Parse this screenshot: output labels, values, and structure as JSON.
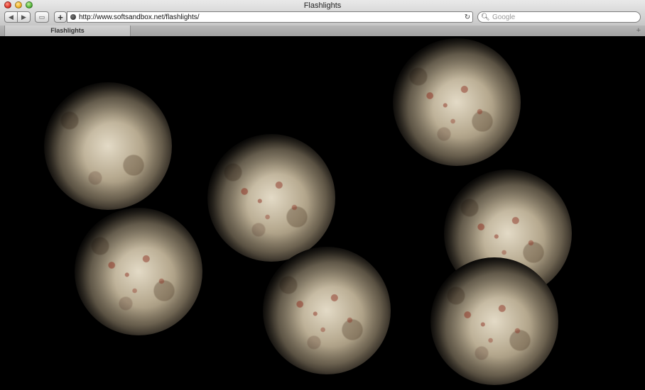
{
  "window": {
    "title": "Flashlights"
  },
  "toolbar": {
    "back_icon": "◀",
    "forward_icon": "▶",
    "snapshot_icon": "▭",
    "add_icon": "+",
    "url": "http://www.softsandbox.net/flashlights/",
    "reload_icon": "↻",
    "search_icon": "🔍︎",
    "search_placeholder": "Google"
  },
  "tabs": [
    {
      "label": "Flashlights"
    }
  ],
  "new_tab_icon": "+",
  "colors": {
    "content_background": "#000000",
    "chrome_gray": "#c7c7c7"
  }
}
